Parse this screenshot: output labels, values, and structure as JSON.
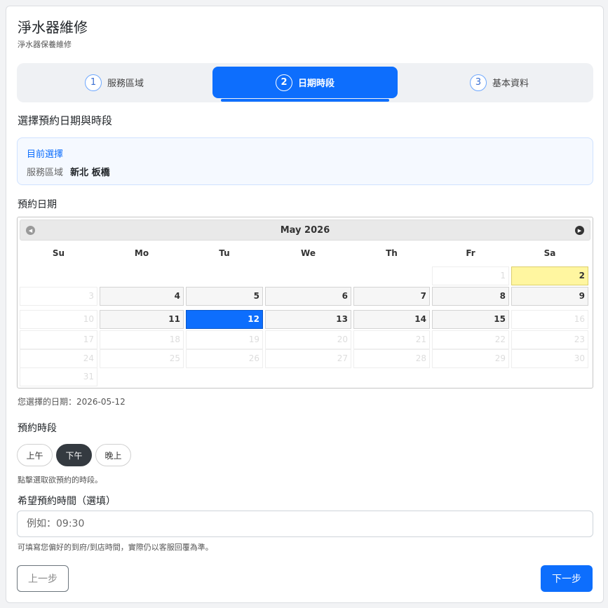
{
  "page": {
    "title": "淨水器維修",
    "subtitle": "淨水器保養維修"
  },
  "steps": [
    {
      "num": "1",
      "label": "服務區域",
      "active": false
    },
    {
      "num": "2",
      "label": "日期時段",
      "active": true
    },
    {
      "num": "3",
      "label": "基本資料",
      "active": false
    }
  ],
  "section_title": "選擇預約日期與時段",
  "current_selection": {
    "label": "目前選擇",
    "area_label": "服務區域",
    "area_value": "新北 板橋"
  },
  "date_heading": "預約日期",
  "calendar": {
    "month_title": "May 2026",
    "prev_icon": "◀",
    "next_icon": "▶",
    "weekdays": [
      "Su",
      "Mo",
      "Tu",
      "We",
      "Th",
      "Fr",
      "Sa"
    ],
    "days": [
      {
        "d": "1",
        "state": "disabled"
      },
      {
        "d": "2",
        "state": "today"
      },
      {
        "d": "3",
        "state": "disabled"
      },
      {
        "d": "4",
        "state": "available"
      },
      {
        "d": "5",
        "state": "available"
      },
      {
        "d": "6",
        "state": "available"
      },
      {
        "d": "7",
        "state": "available"
      },
      {
        "d": "8",
        "state": "available"
      },
      {
        "d": "9",
        "state": "available"
      },
      {
        "d": "10",
        "state": "disabled"
      },
      {
        "d": "11",
        "state": "available"
      },
      {
        "d": "12",
        "state": "selected"
      },
      {
        "d": "13",
        "state": "available"
      },
      {
        "d": "14",
        "state": "available"
      },
      {
        "d": "15",
        "state": "available"
      },
      {
        "d": "16",
        "state": "disabled"
      },
      {
        "d": "17",
        "state": "disabled"
      },
      {
        "d": "18",
        "state": "disabled"
      },
      {
        "d": "19",
        "state": "disabled"
      },
      {
        "d": "20",
        "state": "disabled"
      },
      {
        "d": "21",
        "state": "disabled"
      },
      {
        "d": "22",
        "state": "disabled"
      },
      {
        "d": "23",
        "state": "disabled"
      },
      {
        "d": "24",
        "state": "disabled"
      },
      {
        "d": "25",
        "state": "disabled"
      },
      {
        "d": "26",
        "state": "disabled"
      },
      {
        "d": "27",
        "state": "disabled"
      },
      {
        "d": "28",
        "state": "disabled"
      },
      {
        "d": "29",
        "state": "disabled"
      },
      {
        "d": "30",
        "state": "disabled"
      },
      {
        "d": "31",
        "state": "disabled"
      }
    ],
    "first_weekday": 5
  },
  "picked_date": "您選擇的日期：2026-05-12",
  "slot_heading": "預約時段",
  "slots": [
    {
      "label": "上午",
      "active": false
    },
    {
      "label": "下午",
      "active": true
    },
    {
      "label": "晚上",
      "active": false
    }
  ],
  "slot_hint": "點擊選取欲預約的時段。",
  "time_heading": "希望預約時間（選填）",
  "time_input": {
    "value": "",
    "placeholder": "例如：09:30"
  },
  "time_hint": "可填寫您偏好的到府/到店時間，實際仍以客服回覆為準。",
  "buttons": {
    "prev": "上一步",
    "next": "下一步"
  },
  "colors": {
    "accent": "#0d6efd",
    "today": "#fff6a0",
    "slot_active": "#343a40"
  }
}
